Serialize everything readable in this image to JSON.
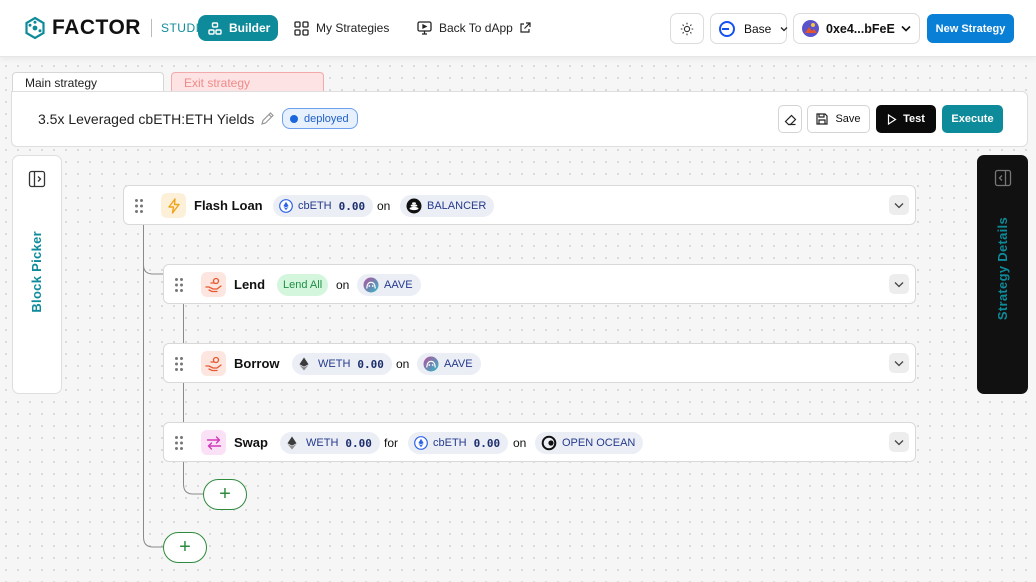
{
  "header": {
    "logo_text": "FACTOR",
    "studio_label": "STUDIO",
    "nav": {
      "builder": "Builder",
      "my_strategies": "My Strategies",
      "back_to_dapp": "Back To dApp"
    },
    "network": "Base",
    "wallet": "0xe4...bFeE",
    "new_strategy": "New Strategy"
  },
  "tabs": {
    "main": "Main strategy",
    "exit": "Exit strategy"
  },
  "strategy": {
    "title": "3.5x Leveraged cbETH:ETH Yields",
    "status": "deployed",
    "save": "Save",
    "test": "Test",
    "execute": "Execute"
  },
  "panels": {
    "block_picker": "Block Picker",
    "strategy_details": "Strategy Details"
  },
  "blocks": [
    {
      "title": "Flash Loan",
      "token": "cbETH",
      "amount": "0.00",
      "on": "on",
      "protocol": "BALANCER"
    },
    {
      "title": "Lend",
      "tag": "Lend All",
      "on": "on",
      "protocol": "AAVE"
    },
    {
      "title": "Borrow",
      "token": "WETH",
      "amount": "0.00",
      "on": "on",
      "protocol": "AAVE"
    },
    {
      "title": "Swap",
      "token": "WETH",
      "amount": "0.00",
      "for": "for",
      "token2": "cbETH",
      "amount2": "0.00",
      "on": "on",
      "protocol": "OPEN OCEAN"
    }
  ],
  "add_symbol": "+",
  "colors": {
    "brand": "#0e8b9a",
    "primary_blue": "#0a7fd6",
    "add_green": "#2e8b3d",
    "flash_icon_bg": "#fdf0d9",
    "lend_icon_bg": "#fde6e0",
    "swap_icon_bg": "#fbe1f6"
  }
}
